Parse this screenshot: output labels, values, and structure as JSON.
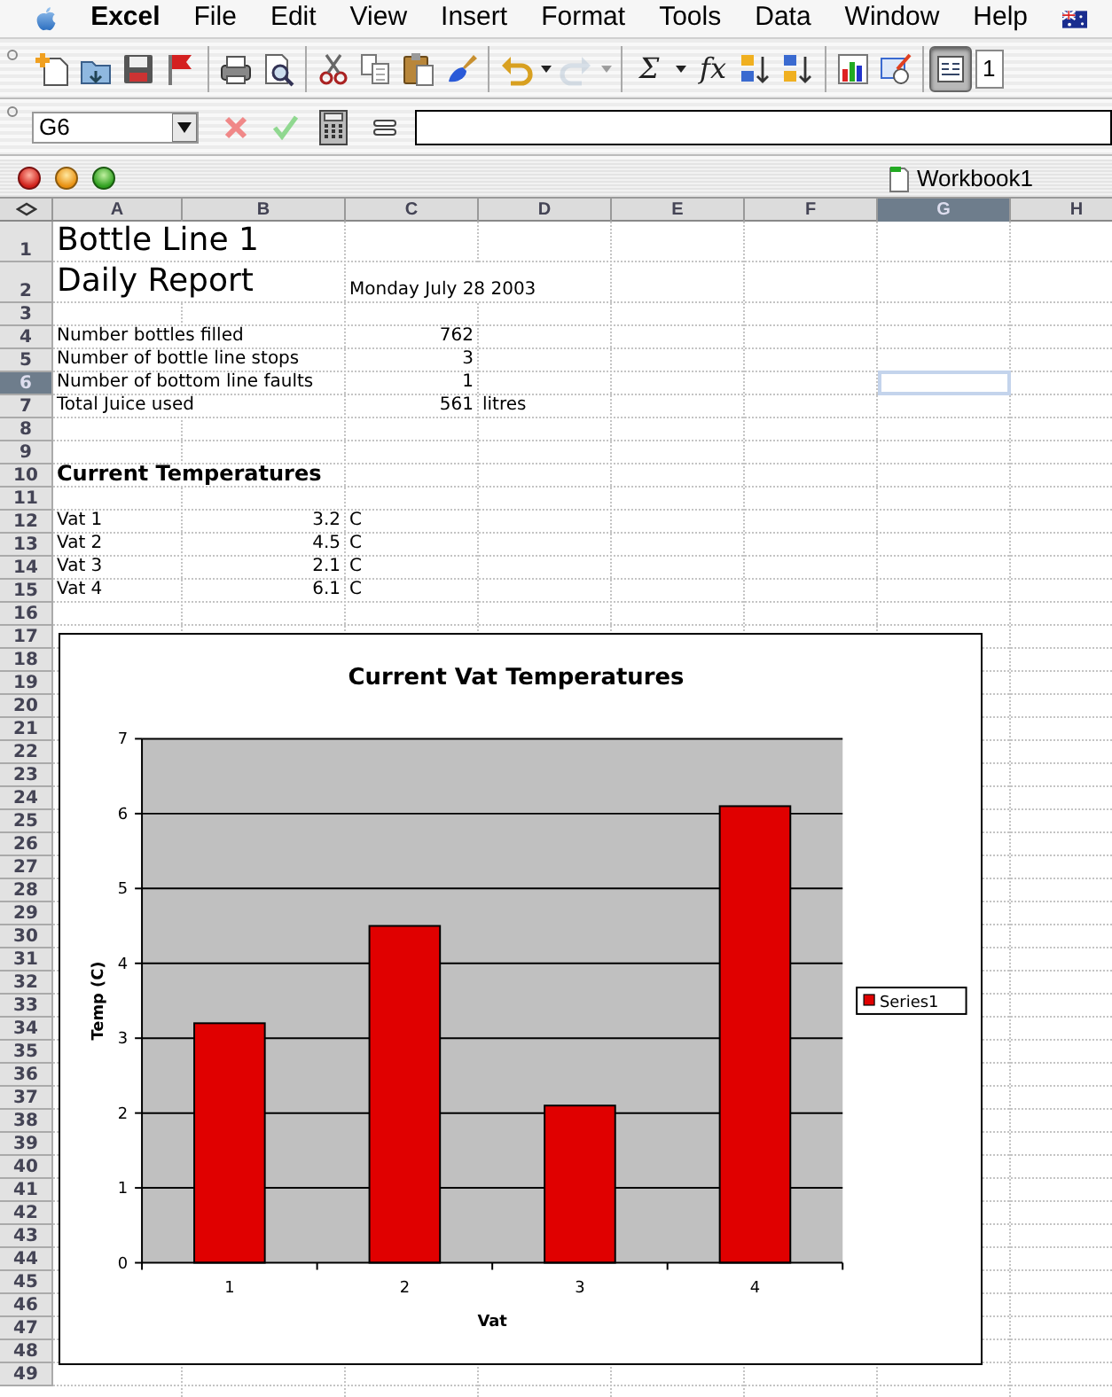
{
  "menu_bar": {
    "items": [
      {
        "label": "Excel",
        "kind": "app"
      },
      {
        "label": "File",
        "kind": "menu"
      },
      {
        "label": "Edit",
        "kind": "menu"
      },
      {
        "label": "View",
        "kind": "menu"
      },
      {
        "label": "Insert",
        "kind": "menu"
      },
      {
        "label": "Format",
        "kind": "menu"
      },
      {
        "label": "Tools",
        "kind": "menu"
      },
      {
        "label": "Data",
        "kind": "menu"
      },
      {
        "label": "Window",
        "kind": "menu"
      },
      {
        "label": "Help",
        "kind": "menu"
      }
    ]
  },
  "toolbar": {
    "items": [
      {
        "kind": "new",
        "disabled": false,
        "pressed": false
      },
      {
        "kind": "open",
        "disabled": false,
        "pressed": false
      },
      {
        "kind": "save",
        "disabled": false,
        "pressed": false
      },
      {
        "kind": "flag",
        "disabled": false,
        "pressed": false
      },
      {
        "kind": "separator"
      },
      {
        "kind": "print",
        "disabled": false,
        "pressed": false
      },
      {
        "kind": "preview",
        "disabled": false,
        "pressed": false
      },
      {
        "kind": "separator"
      },
      {
        "kind": "cut",
        "disabled": false,
        "pressed": false
      },
      {
        "kind": "copy",
        "disabled": false,
        "pressed": false
      },
      {
        "kind": "paste",
        "disabled": false,
        "pressed": false
      },
      {
        "kind": "brush",
        "disabled": false,
        "pressed": false
      },
      {
        "kind": "separator"
      },
      {
        "kind": "undo",
        "disabled": false,
        "pressed": false
      },
      {
        "kind": "redo",
        "disabled": true,
        "pressed": false
      },
      {
        "kind": "separator"
      },
      {
        "kind": "text",
        "label": "Σ",
        "disabled": false,
        "pressed": false,
        "menu": true
      },
      {
        "kind": "text",
        "label": "fx",
        "disabled": false,
        "pressed": false,
        "menu": false
      },
      {
        "kind": "sort_up",
        "disabled": false,
        "pressed": false
      },
      {
        "kind": "sort_down",
        "disabled": false,
        "pressed": false
      },
      {
        "kind": "separator"
      },
      {
        "kind": "chart",
        "disabled": false,
        "pressed": false
      },
      {
        "kind": "draw",
        "disabled": false,
        "pressed": false
      },
      {
        "kind": "separator"
      },
      {
        "kind": "textbox",
        "disabled": false,
        "pressed": true
      }
    ],
    "font_size": "1"
  },
  "formula_bar": {
    "name_box": "G6"
  },
  "window": {
    "title": "Workbook1"
  },
  "sheet": {
    "columns": [
      {
        "label": "A",
        "selected": false
      },
      {
        "label": "B",
        "selected": false
      },
      {
        "label": "C",
        "selected": false
      },
      {
        "label": "D",
        "selected": false
      },
      {
        "label": "E",
        "selected": false
      },
      {
        "label": "F",
        "selected": false
      },
      {
        "label": "G",
        "selected": true
      },
      {
        "label": "H",
        "selected": false
      }
    ],
    "rows": [
      {
        "label": "1",
        "selected": false,
        "cells": [
          {
            "text": "Bottle Line 1",
            "kind": "title"
          }
        ]
      },
      {
        "label": "2",
        "selected": false,
        "cells": [
          {
            "text": "Daily Report",
            "kind": "title"
          },
          null,
          {
            "text": "Monday July 28 2003",
            "kind": "text"
          }
        ]
      },
      {
        "label": "3",
        "selected": false
      },
      {
        "label": "4",
        "selected": false,
        "cells": [
          {
            "text": "Number bottles filled",
            "kind": "text"
          },
          null,
          {
            "text": "762",
            "kind": "number"
          }
        ]
      },
      {
        "label": "5",
        "selected": false,
        "cells": [
          {
            "text": "Number of bottle line stops",
            "kind": "text"
          },
          null,
          {
            "text": "3",
            "kind": "number"
          }
        ]
      },
      {
        "label": "6",
        "selected": true,
        "cells": [
          {
            "text": "Number of bottom line faults",
            "kind": "text"
          },
          null,
          {
            "text": "1",
            "kind": "number"
          }
        ]
      },
      {
        "label": "7",
        "selected": false,
        "cells": [
          {
            "text": "Total Juice used",
            "kind": "text"
          },
          null,
          {
            "text": "561",
            "kind": "number"
          },
          {
            "text": "litres",
            "kind": "text"
          }
        ]
      },
      {
        "label": "8",
        "selected": false
      },
      {
        "label": "9",
        "selected": false
      },
      {
        "label": "10",
        "selected": false,
        "cells": [
          {
            "text": "Current Temperatures",
            "kind": "heading"
          }
        ]
      },
      {
        "label": "11",
        "selected": false
      },
      {
        "label": "12",
        "selected": false,
        "cells": [
          {
            "text": "Vat 1",
            "kind": "text"
          },
          {
            "text": "3.2",
            "kind": "number"
          },
          {
            "text": "C",
            "kind": "text"
          }
        ]
      },
      {
        "label": "13",
        "selected": false,
        "cells": [
          {
            "text": "Vat 2",
            "kind": "text"
          },
          {
            "text": "4.5",
            "kind": "number"
          },
          {
            "text": "C",
            "kind": "text"
          }
        ]
      },
      {
        "label": "14",
        "selected": false,
        "cells": [
          {
            "text": "Vat 3",
            "kind": "text"
          },
          {
            "text": "2.1",
            "kind": "number"
          },
          {
            "text": "C",
            "kind": "text"
          }
        ]
      },
      {
        "label": "15",
        "selected": false,
        "cells": [
          {
            "text": "Vat 4",
            "kind": "text"
          },
          {
            "text": "6.1",
            "kind": "number"
          },
          {
            "text": "C",
            "kind": "text"
          }
        ]
      },
      {
        "label": "16",
        "selected": false
      },
      {
        "label": "17",
        "selected": false
      },
      {
        "label": "18",
        "selected": false
      },
      {
        "label": "19",
        "selected": false
      },
      {
        "label": "20",
        "selected": false
      },
      {
        "label": "21",
        "selected": false
      },
      {
        "label": "22",
        "selected": false
      },
      {
        "label": "23",
        "selected": false
      },
      {
        "label": "24",
        "selected": false
      },
      {
        "label": "25",
        "selected": false
      },
      {
        "label": "26",
        "selected": false
      },
      {
        "label": "27",
        "selected": false
      },
      {
        "label": "28",
        "selected": false
      },
      {
        "label": "29",
        "selected": false
      },
      {
        "label": "30",
        "selected": false
      },
      {
        "label": "31",
        "selected": false
      },
      {
        "label": "32",
        "selected": false
      },
      {
        "label": "33",
        "selected": false
      },
      {
        "label": "34",
        "selected": false
      },
      {
        "label": "35",
        "selected": false
      },
      {
        "label": "36",
        "selected": false
      },
      {
        "label": "37",
        "selected": false
      },
      {
        "label": "38",
        "selected": false
      },
      {
        "label": "39",
        "selected": false
      },
      {
        "label": "40",
        "selected": false
      },
      {
        "label": "41",
        "selected": false
      },
      {
        "label": "42",
        "selected": false
      },
      {
        "label": "43",
        "selected": false
      },
      {
        "label": "44",
        "selected": false
      },
      {
        "label": "45",
        "selected": false
      },
      {
        "label": "46",
        "selected": false
      },
      {
        "label": "47",
        "selected": false
      },
      {
        "label": "48",
        "selected": false
      },
      {
        "label": "49",
        "selected": false
      }
    ],
    "chart": {
      "chart_data": {
        "type": "bar",
        "grid": true,
        "title": "Current Vat Temperatures",
        "xlabel": "Vat",
        "ylabel": "Temp (C)",
        "categories": [
          "1",
          "2",
          "3",
          "4"
        ],
        "series": [
          {
            "name": "Series1",
            "color": "#e00000",
            "values": [
              3.2,
              4.5,
              2.1,
              6.1
            ]
          }
        ],
        "ylim": [
          0,
          7
        ],
        "yticks": [
          0,
          1,
          2,
          3,
          4,
          5,
          6,
          7
        ]
      }
    }
  }
}
